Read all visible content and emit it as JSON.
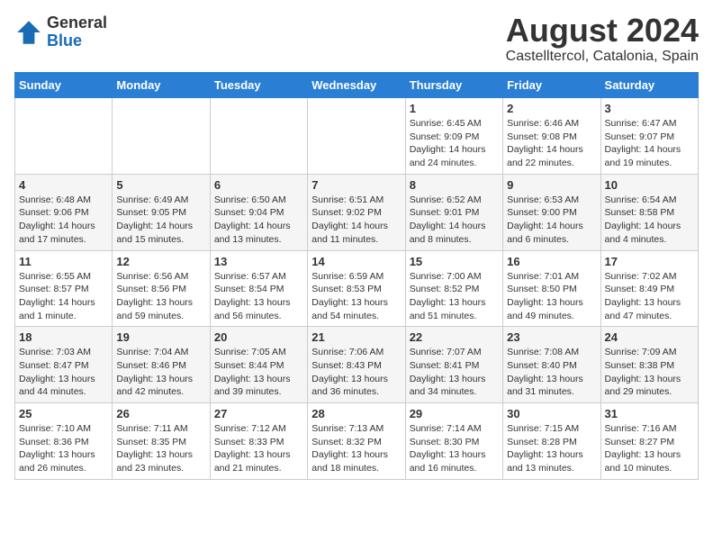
{
  "logo": {
    "general": "General",
    "blue": "Blue"
  },
  "title": {
    "month_year": "August 2024",
    "location": "Castelltercol, Catalonia, Spain"
  },
  "weekdays": [
    "Sunday",
    "Monday",
    "Tuesday",
    "Wednesday",
    "Thursday",
    "Friday",
    "Saturday"
  ],
  "weeks": [
    [
      {
        "day": "",
        "info": ""
      },
      {
        "day": "",
        "info": ""
      },
      {
        "day": "",
        "info": ""
      },
      {
        "day": "",
        "info": ""
      },
      {
        "day": "1",
        "info": "Sunrise: 6:45 AM\nSunset: 9:09 PM\nDaylight: 14 hours\nand 24 minutes."
      },
      {
        "day": "2",
        "info": "Sunrise: 6:46 AM\nSunset: 9:08 PM\nDaylight: 14 hours\nand 22 minutes."
      },
      {
        "day": "3",
        "info": "Sunrise: 6:47 AM\nSunset: 9:07 PM\nDaylight: 14 hours\nand 19 minutes."
      }
    ],
    [
      {
        "day": "4",
        "info": "Sunrise: 6:48 AM\nSunset: 9:06 PM\nDaylight: 14 hours\nand 17 minutes."
      },
      {
        "day": "5",
        "info": "Sunrise: 6:49 AM\nSunset: 9:05 PM\nDaylight: 14 hours\nand 15 minutes."
      },
      {
        "day": "6",
        "info": "Sunrise: 6:50 AM\nSunset: 9:04 PM\nDaylight: 14 hours\nand 13 minutes."
      },
      {
        "day": "7",
        "info": "Sunrise: 6:51 AM\nSunset: 9:02 PM\nDaylight: 14 hours\nand 11 minutes."
      },
      {
        "day": "8",
        "info": "Sunrise: 6:52 AM\nSunset: 9:01 PM\nDaylight: 14 hours\nand 8 minutes."
      },
      {
        "day": "9",
        "info": "Sunrise: 6:53 AM\nSunset: 9:00 PM\nDaylight: 14 hours\nand 6 minutes."
      },
      {
        "day": "10",
        "info": "Sunrise: 6:54 AM\nSunset: 8:58 PM\nDaylight: 14 hours\nand 4 minutes."
      }
    ],
    [
      {
        "day": "11",
        "info": "Sunrise: 6:55 AM\nSunset: 8:57 PM\nDaylight: 14 hours\nand 1 minute."
      },
      {
        "day": "12",
        "info": "Sunrise: 6:56 AM\nSunset: 8:56 PM\nDaylight: 13 hours\nand 59 minutes."
      },
      {
        "day": "13",
        "info": "Sunrise: 6:57 AM\nSunset: 8:54 PM\nDaylight: 13 hours\nand 56 minutes."
      },
      {
        "day": "14",
        "info": "Sunrise: 6:59 AM\nSunset: 8:53 PM\nDaylight: 13 hours\nand 54 minutes."
      },
      {
        "day": "15",
        "info": "Sunrise: 7:00 AM\nSunset: 8:52 PM\nDaylight: 13 hours\nand 51 minutes."
      },
      {
        "day": "16",
        "info": "Sunrise: 7:01 AM\nSunset: 8:50 PM\nDaylight: 13 hours\nand 49 minutes."
      },
      {
        "day": "17",
        "info": "Sunrise: 7:02 AM\nSunset: 8:49 PM\nDaylight: 13 hours\nand 47 minutes."
      }
    ],
    [
      {
        "day": "18",
        "info": "Sunrise: 7:03 AM\nSunset: 8:47 PM\nDaylight: 13 hours\nand 44 minutes."
      },
      {
        "day": "19",
        "info": "Sunrise: 7:04 AM\nSunset: 8:46 PM\nDaylight: 13 hours\nand 42 minutes."
      },
      {
        "day": "20",
        "info": "Sunrise: 7:05 AM\nSunset: 8:44 PM\nDaylight: 13 hours\nand 39 minutes."
      },
      {
        "day": "21",
        "info": "Sunrise: 7:06 AM\nSunset: 8:43 PM\nDaylight: 13 hours\nand 36 minutes."
      },
      {
        "day": "22",
        "info": "Sunrise: 7:07 AM\nSunset: 8:41 PM\nDaylight: 13 hours\nand 34 minutes."
      },
      {
        "day": "23",
        "info": "Sunrise: 7:08 AM\nSunset: 8:40 PM\nDaylight: 13 hours\nand 31 minutes."
      },
      {
        "day": "24",
        "info": "Sunrise: 7:09 AM\nSunset: 8:38 PM\nDaylight: 13 hours\nand 29 minutes."
      }
    ],
    [
      {
        "day": "25",
        "info": "Sunrise: 7:10 AM\nSunset: 8:36 PM\nDaylight: 13 hours\nand 26 minutes."
      },
      {
        "day": "26",
        "info": "Sunrise: 7:11 AM\nSunset: 8:35 PM\nDaylight: 13 hours\nand 23 minutes."
      },
      {
        "day": "27",
        "info": "Sunrise: 7:12 AM\nSunset: 8:33 PM\nDaylight: 13 hours\nand 21 minutes."
      },
      {
        "day": "28",
        "info": "Sunrise: 7:13 AM\nSunset: 8:32 PM\nDaylight: 13 hours\nand 18 minutes."
      },
      {
        "day": "29",
        "info": "Sunrise: 7:14 AM\nSunset: 8:30 PM\nDaylight: 13 hours\nand 16 minutes."
      },
      {
        "day": "30",
        "info": "Sunrise: 7:15 AM\nSunset: 8:28 PM\nDaylight: 13 hours\nand 13 minutes."
      },
      {
        "day": "31",
        "info": "Sunrise: 7:16 AM\nSunset: 8:27 PM\nDaylight: 13 hours\nand 10 minutes."
      }
    ]
  ]
}
